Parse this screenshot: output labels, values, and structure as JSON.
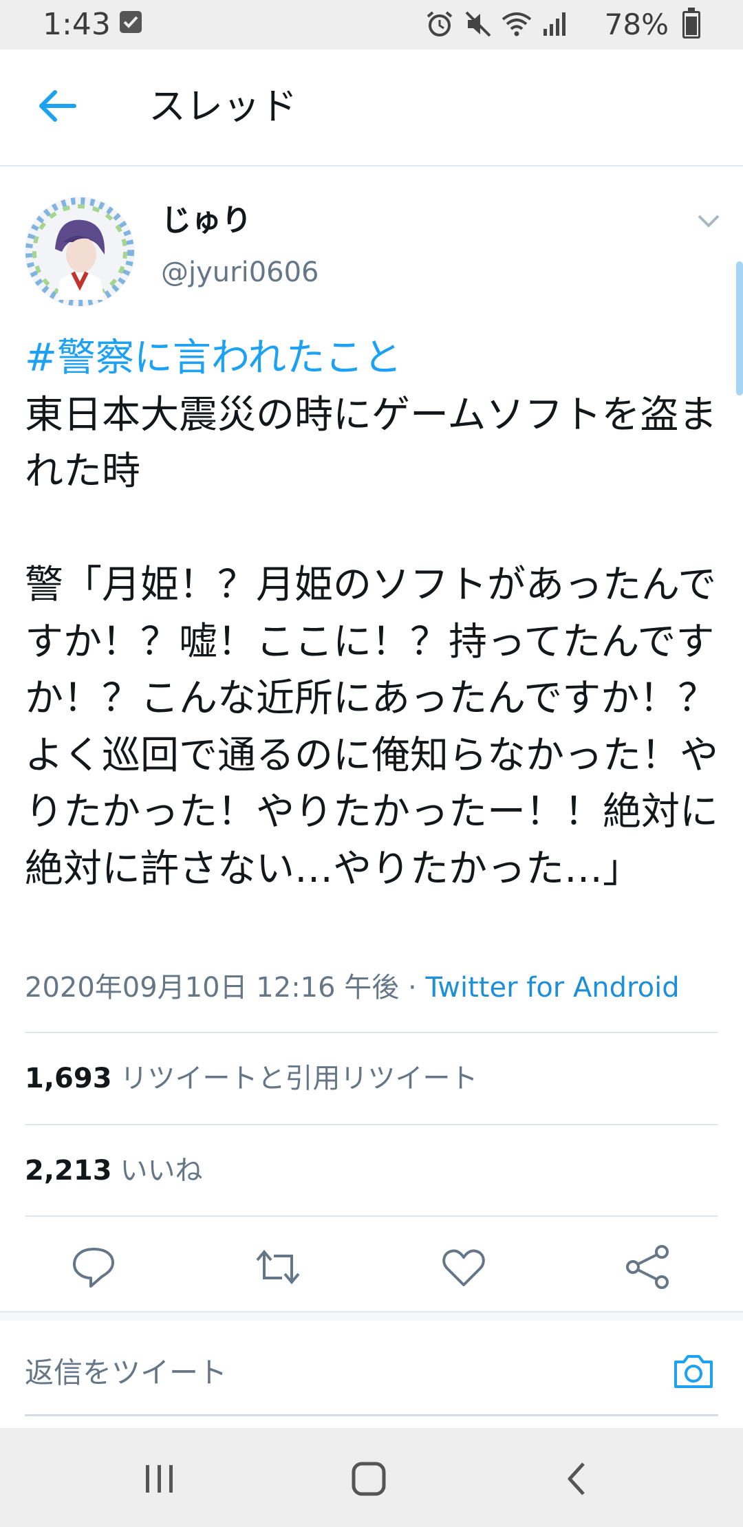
{
  "status_bar": {
    "time": "1:43",
    "battery_percent": "78%",
    "icons": [
      "checkbox-notification-icon",
      "alarm-icon",
      "mute-icon",
      "wifi-icon",
      "signal-icon",
      "battery-icon"
    ]
  },
  "app_bar": {
    "back_icon": "arrow-left-icon",
    "title": "スレッド"
  },
  "tweet": {
    "display_name": "じゅり",
    "handle": "@jyuri0606",
    "hashtag": "#警察に言われたこと",
    "body": "東日本大震災の時にゲームソフトを盗まれた時\n\n警「月姫！？月姫のソフトがあったんですか！？嘘！ここに！？持ってたんですか！？こんな近所にあったんですか！？よく巡回で通るのに俺知らなかった！やりたかった！やりたかったー！！絶対に絶対に許さない…やりたかった…」",
    "timestamp": "2020年09月10日 12:16 午後",
    "separator": " · ",
    "source": "Twitter for Android"
  },
  "stats": {
    "retweets_count": "1,693",
    "retweets_label": "リツイートと引用リツイート",
    "likes_count": "2,213",
    "likes_label": "いいね"
  },
  "actions": [
    "reply-icon",
    "retweet-icon",
    "like-icon",
    "share-icon"
  ],
  "reply": {
    "placeholder": "返信をツイート",
    "camera_icon": "camera-icon"
  },
  "colors": {
    "accent": "#1da1f2",
    "text": "#14171a",
    "secondary": "#657786"
  }
}
